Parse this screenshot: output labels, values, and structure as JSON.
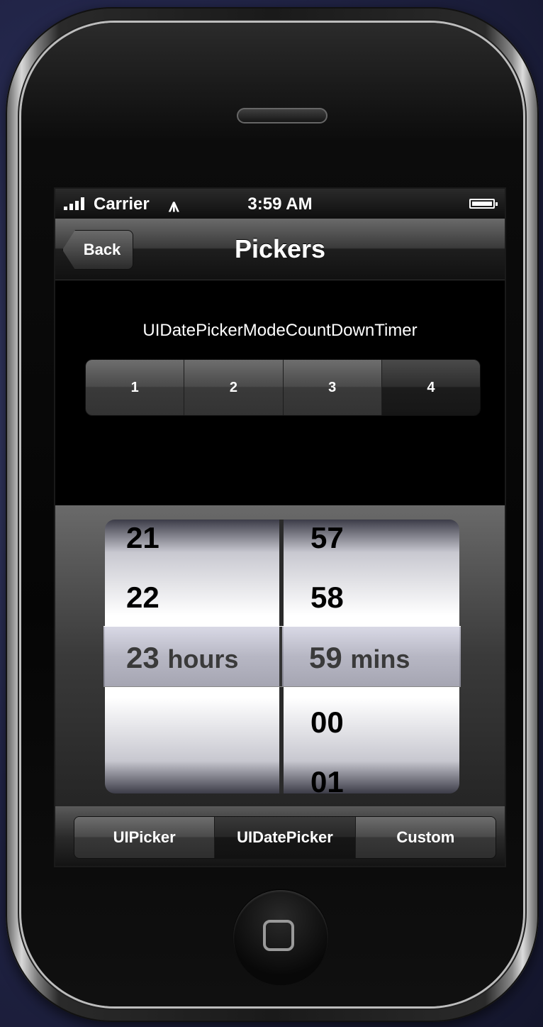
{
  "status_bar": {
    "carrier": "Carrier",
    "time": "3:59 AM"
  },
  "nav": {
    "back_label": "Back",
    "title": "Pickers"
  },
  "mode_label": "UIDatePickerModeCountDownTimer",
  "segments": [
    "1",
    "2",
    "3",
    "4"
  ],
  "selected_segment": "4",
  "picker": {
    "hours": [
      "21",
      "22",
      "23",
      ""
    ],
    "minutes": [
      "57",
      "58",
      "59",
      "00",
      "01"
    ],
    "selected_hours": "23",
    "hours_unit": "hours",
    "selected_minutes": "59",
    "minutes_unit": "mins"
  },
  "tabs": [
    "UIPicker",
    "UIDatePicker",
    "Custom"
  ],
  "selected_tab": "UIDatePicker"
}
